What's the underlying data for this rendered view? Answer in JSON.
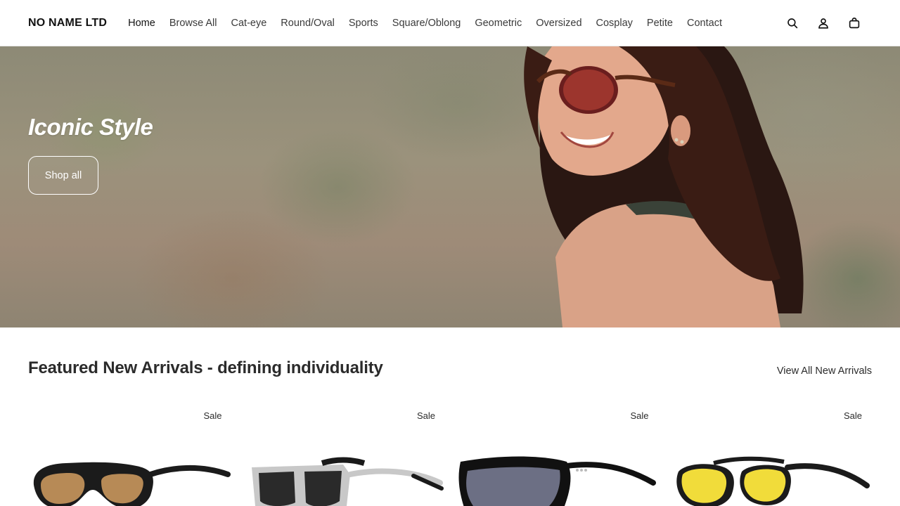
{
  "header": {
    "logo": "NO NAME LTD",
    "nav": [
      "Home",
      "Browse All",
      "Cat-eye",
      "Round/Oval",
      "Sports",
      "Square/Oblong",
      "Geometric",
      "Oversized",
      "Cosplay",
      "Petite",
      "Contact"
    ],
    "icons": [
      "search-icon",
      "account-icon",
      "cart-icon"
    ]
  },
  "hero": {
    "title": "Iconic Style",
    "button_label": "Shop all"
  },
  "featured": {
    "heading": "Featured New Arrivals - defining individuality",
    "view_all_label": "View All New Arrivals",
    "products": [
      {
        "badge": "Sale",
        "lens_color": "#b78a56",
        "frame_color": "#1b1b1b"
      },
      {
        "badge": "Sale",
        "lens_color": "#2a2a2a",
        "frame_color": "#c8c8c8"
      },
      {
        "badge": "Sale",
        "lens_color": "#6c6f84",
        "frame_color": "#111111"
      },
      {
        "badge": "Sale",
        "lens_color": "#f1dc3a",
        "frame_color": "#1b1b1b"
      }
    ]
  },
  "colors": {
    "text": "#121212",
    "hero_text": "#ffffff"
  }
}
